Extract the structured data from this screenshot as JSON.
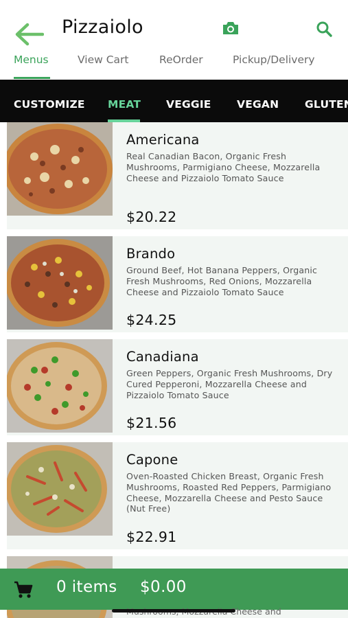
{
  "header": {
    "title": "Pizzaiolo",
    "back_icon": "arrow-left-icon",
    "camera_icon": "camera-icon",
    "search_icon": "search-icon",
    "accent": "#3aa35a"
  },
  "tabs": [
    {
      "label": "Menus",
      "active": true
    },
    {
      "label": "View Cart",
      "active": false
    },
    {
      "label": "ReOrder",
      "active": false
    },
    {
      "label": "Pickup/Delivery",
      "active": false
    }
  ],
  "categories": [
    {
      "label": "CUSTOMIZE",
      "active": false
    },
    {
      "label": "MEAT",
      "active": true
    },
    {
      "label": "VEGGIE",
      "active": false
    },
    {
      "label": "VEGAN",
      "active": false
    },
    {
      "label": "GLUTEN",
      "active": false
    }
  ],
  "items": [
    {
      "name": "Americana",
      "description": "Real Canadian Bacon, Organic Fresh Mushrooms, Parmigiano Cheese, Mozzarella Cheese and Pizzaiolo Tomato Sauce",
      "price": "$20.22"
    },
    {
      "name": "Brando",
      "description": "Ground Beef, Hot Banana Peppers, Organic Fresh Mushrooms, Red Onions, Mozzarella Cheese and Pizzaiolo Tomato Sauce",
      "price": "$24.25"
    },
    {
      "name": "Canadiana",
      "description": "Green Peppers, Organic Fresh Mushrooms, Dry Cured Pepperoni, Mozzarella Cheese and Pizzaiolo Tomato Sauce",
      "price": "$21.56"
    },
    {
      "name": "Capone",
      "description": "Oven-Roasted Chicken Breast, Organic Fresh Mushrooms, Roasted Red Peppers, Parmigiano Cheese, Mozzarella Cheese and Pesto Sauce (Nut Free)",
      "price": "$22.91"
    }
  ],
  "peek_description": "Mushrooms, Mozzarella Cheese and",
  "cart": {
    "icon": "shopping-cart-icon",
    "items_label": "0 items",
    "total": "$0.00",
    "color": "#3f9a55"
  }
}
